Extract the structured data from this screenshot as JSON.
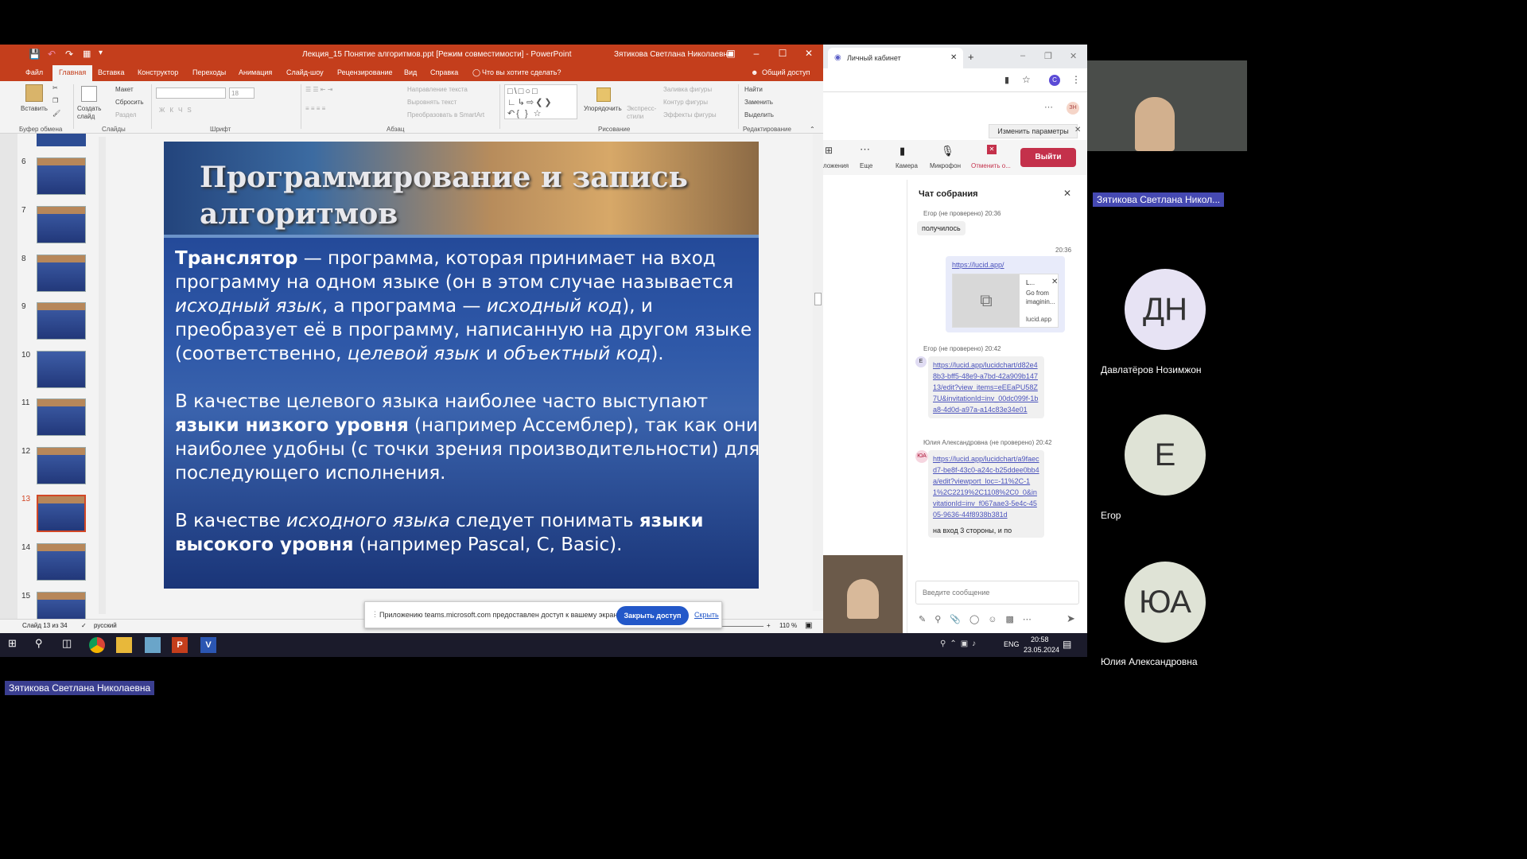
{
  "ppt": {
    "title": "Лекция_15 Понятие алгоритмов.ppt [Режим совместимости] - PowerPoint",
    "user": "Зятикова Светлана Николаевна",
    "tabs": [
      "Файл",
      "Главная",
      "Вставка",
      "Конструктор",
      "Переходы",
      "Анимация",
      "Слайд-шоу",
      "Рецензирование",
      "Вид",
      "Справка"
    ],
    "tell_me": "Что вы хотите сделать?",
    "share": "Общий доступ",
    "ribbon": {
      "paste": "Вставить",
      "clipboard_group": "Буфер обмена",
      "new_slide": "Создать слайд",
      "layout": "Макет",
      "reset": "Сбросить",
      "section": "Раздел",
      "slides_group": "Слайды",
      "font_size": "18",
      "font_group": "Шрифт",
      "text_dir": "Направление текста",
      "align_text": "Выровнять текст",
      "smartart": "Преобразовать в SmartArt",
      "paragraph_group": "Абзац",
      "arrange": "Упорядочить",
      "quick_styles": "Экспресс-стили",
      "shape_fill": "Заливка фигуры",
      "shape_outline": "Контур фигуры",
      "shape_effects": "Эффекты фигуры",
      "drawing_group": "Рисование",
      "find": "Найти",
      "replace": "Заменить",
      "select": "Выделить",
      "editing_group": "Редактирование"
    },
    "thumbs": [
      "6",
      "7",
      "8",
      "9",
      "10",
      "11",
      "12",
      "13",
      "14",
      "15"
    ],
    "slide": {
      "title_line1": "Программирование и запись",
      "title_line2": "алгоритмов",
      "p1_b": "Транслятор",
      "p1_t1": " — программа, которая принимает на вход программу на одном языке (он в этом случае называется ",
      "p1_i1": "исходный язык",
      "p1_t2": ", а программа — ",
      "p1_i2": "исходный код",
      "p1_t3": "), и преобразует её в программу, написанную на другом языке (соответственно, ",
      "p1_i3": "целевой язык",
      "p1_t4": " и ",
      "p1_i4": "объектный код",
      "p1_t5": ").",
      "p2_t1": "В качестве целевого языка наиболее часто выступают ",
      "p2_b": "языки низкого уровня",
      "p2_t2": " (например Ассемблер), так как они наиболее удобны (с точки зрения производительности) для последующего исполнения.",
      "p3_t1": "В качестве ",
      "p3_i": "исходного языка",
      "p3_t2": " следует понимать ",
      "p3_b": "языки высокого уровня",
      "p3_t3": " (например Pascal, C, Basic)."
    },
    "status_slide": "Слайд 13 из 34",
    "status_lang": "русский",
    "zoom": "110 %",
    "share_msg": "Приложению teams.microsoft.com предоставлен доступ к вашему экрану.",
    "share_stop": "Закрыть доступ",
    "share_hide": "Скрыть"
  },
  "edge": {
    "tab": "Личный кабинет",
    "profile": "C",
    "change_params": "Изменить параметры",
    "toolbar": {
      "apps": "ложения",
      "more": "Еще",
      "camera": "Камера",
      "mic": "Микрофон",
      "cancel": "Отменить о...",
      "leave": "Выйти"
    }
  },
  "chat": {
    "title": "Чат собрания",
    "m1_meta": "Егор (не проверено)  20:36",
    "m1_text": "получилось",
    "m2_time": "20:36",
    "m2_link": "https://lucid.app/",
    "m2_preview_title": "L...",
    "m2_preview_desc": "Go from imaginin...",
    "m2_preview_site": "lucid.app",
    "m3_meta": "Егор (не проверено)  20:42",
    "m3_link": "https://lucid.app/lucidchart/d82e48b3-bff5-48e9-a7bd-42a909b14713/edit?view_items=eEEaPU58Z7U&invitationId=inv_00dc099f-1ba8-4d0d-a97a-a14c83e34e01",
    "m4_meta": "Юлия Александровна (не проверено)  20:42",
    "m4_link": "https://lucid.app/lucidchart/a9faecd7-be8f-43c0-a24c-b25ddee0bb4a/edit?viewport_loc=-11%2C-11%2C2219%2C1108%2C0_0&invitationId=inv_f067aae3-5e4c-4505-9636-44f8938b381d",
    "m4_text": "на вход 3 стороны, и по",
    "input_placeholder": "Введите сообщение"
  },
  "participants": {
    "presenter": "Зятикова Светлана Никол...",
    "p1_initials": "ДН",
    "p1_name": "Давлатёров Нозимжон",
    "p2_initials": "Е",
    "p2_name": "Егор",
    "p3_initials": "ЮА",
    "p3_name": "Юлия Александровна"
  },
  "taskbar": {
    "lang": "ENG",
    "time": "20:58",
    "date": "23.05.2024"
  },
  "bottom_name": "Зятикова Светлана Николаевна"
}
